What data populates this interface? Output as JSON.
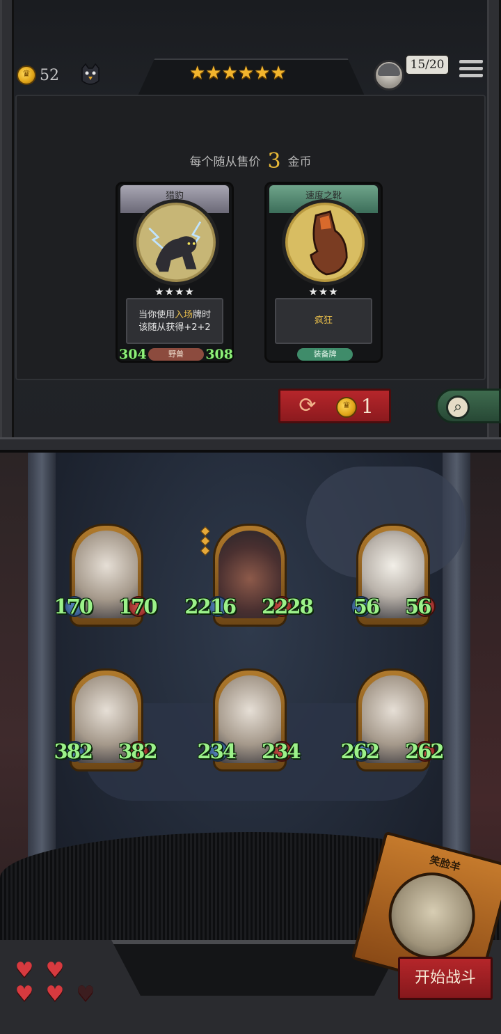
{
  "header": {
    "gold": "52",
    "tier_stars": "★★★★★★",
    "population": "15/20"
  },
  "shop": {
    "sell_text_prefix": "每个随从售价",
    "sell_price": "3",
    "sell_text_suffix": "金币",
    "cards": [
      {
        "name": "猎豹",
        "stars": "★★★★",
        "desc_prefix": "当你使用",
        "desc_highlight": "入场",
        "desc_line1_suffix": "牌时",
        "desc_line2": "该随从获得+2+2",
        "tag": "野兽",
        "attack": "304",
        "health": "308"
      },
      {
        "name": "速度之靴",
        "stars": "★★★",
        "desc": "疯狂",
        "tag": "装备牌"
      }
    ],
    "refresh_cost": "1"
  },
  "board": {
    "units": [
      {
        "attack": "170",
        "health": "170"
      },
      {
        "attack": "2216",
        "health": "2228"
      },
      {
        "attack": "56",
        "health": "56"
      },
      {
        "attack": "382",
        "health": "382"
      },
      {
        "attack": "234",
        "health": "234"
      },
      {
        "attack": "262",
        "health": "262"
      }
    ]
  },
  "hero": {
    "name": "笑脸羊"
  },
  "start_button": "开始战斗",
  "lives": {
    "full": 4,
    "total": 5
  },
  "colors": {
    "accent_gold": "#e8b938",
    "stat_green": "#9cf28a",
    "button_red": "#b5262a"
  }
}
